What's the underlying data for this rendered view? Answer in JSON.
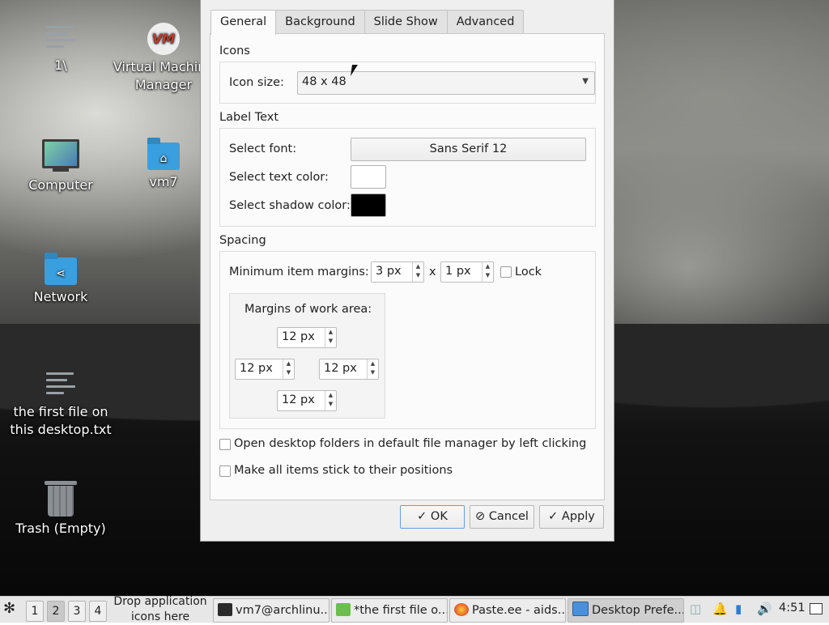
{
  "desktop": {
    "icons": [
      {
        "label": "1\\",
        "icon": "text-file-icon"
      },
      {
        "label": "Virtual Machine Manager",
        "icon": "virt-manager-icon",
        "glyph": "VM"
      },
      {
        "label": "Computer",
        "icon": "computer-icon"
      },
      {
        "label": "vm7",
        "icon": "home-folder-icon"
      },
      {
        "label": "Network",
        "icon": "network-folder-icon"
      },
      {
        "label": "the first file on this desktop.txt",
        "icon": "text-file-icon"
      },
      {
        "label": "Trash (Empty)",
        "icon": "trash-icon"
      }
    ]
  },
  "dialog": {
    "tabs": [
      "General",
      "Background",
      "Slide Show",
      "Advanced"
    ],
    "active_tab": "General",
    "icons": {
      "section_title": "Icons",
      "icon_size_label": "Icon size:",
      "icon_size_value": "48 x 48"
    },
    "label_text": {
      "section_title": "Label Text",
      "font_label": "Select font:",
      "font_value": "Sans Serif 12",
      "text_color_label": "Select text color:",
      "text_color": "#ffffff",
      "shadow_color_label": "Select shadow color:",
      "shadow_color": "#000000"
    },
    "spacing": {
      "section_title": "Spacing",
      "min_margins_label": "Minimum item margins:",
      "margin_x": "3 px",
      "separator": "x",
      "margin_y": "1 px",
      "lock_label": "Lock",
      "lock_checked": false,
      "work_area_title": "Margins of work area:",
      "top": "12 px",
      "left": "12 px",
      "right": "12 px",
      "bottom": "12 px"
    },
    "options": [
      {
        "label": "Open desktop folders in default file manager by left clicking",
        "checked": false
      },
      {
        "label": "Make all items stick to their positions",
        "checked": false
      }
    ],
    "buttons": {
      "ok": "OK",
      "cancel": "Cancel",
      "apply": "Apply"
    }
  },
  "taskbar": {
    "workspaces": [
      "1",
      "2",
      "3",
      "4"
    ],
    "active_workspace": "2",
    "drop_hint": "Drop application icons here",
    "tasks": [
      {
        "label": "vm7@archlinu...",
        "icon": "terminal-icon"
      },
      {
        "label": "*the first file o...",
        "icon": "text-editor-icon"
      },
      {
        "label": "Paste.ee - aids...",
        "icon": "firefox-icon"
      },
      {
        "label": "Desktop Prefe...",
        "icon": "preferences-window-icon"
      }
    ],
    "clock": "4:51",
    "accent": "#4a90d9"
  }
}
